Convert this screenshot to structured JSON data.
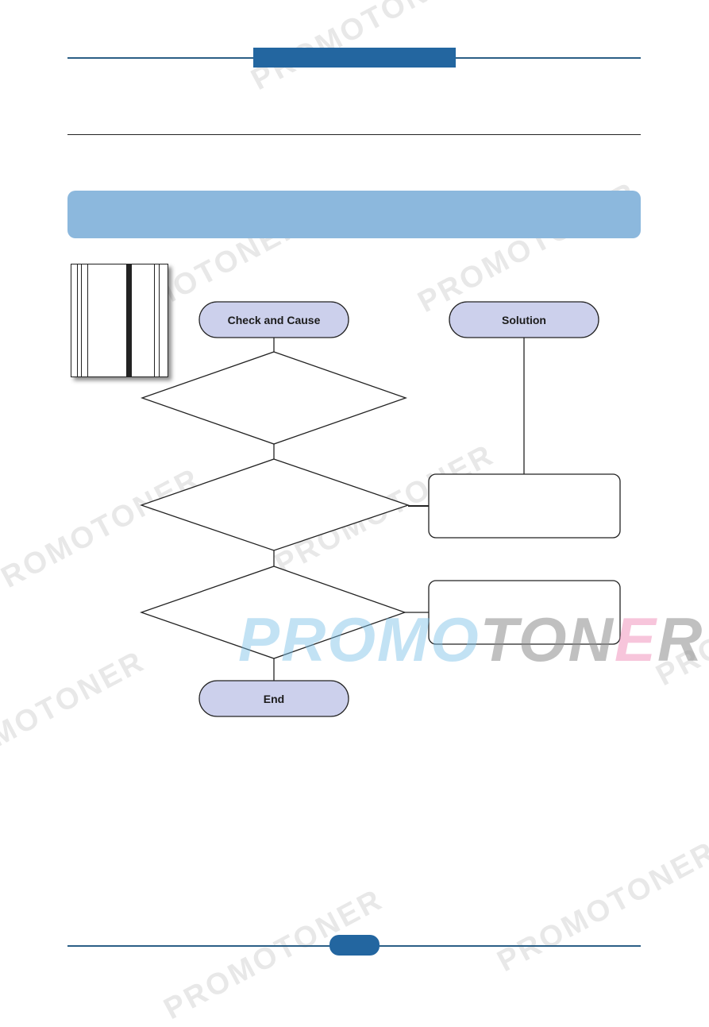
{
  "header": {
    "section_tab": "",
    "title": ""
  },
  "banner": {
    "text": ""
  },
  "sample_image": {
    "icon": "vertical-lines-print-sample",
    "defect": "vertical lines"
  },
  "flowchart": {
    "start_label": "Check and Cause",
    "solution_label": "Solution",
    "end_label": "End",
    "decisions": [
      "",
      "",
      ""
    ],
    "solutions": [
      "",
      ""
    ]
  },
  "footer": {
    "page_number": ""
  },
  "watermark": {
    "text": "PROMOTONER",
    "logo_part1": "PROMO",
    "logo_part2": "TON",
    "logo_part3": "E",
    "logo_part4": "R"
  }
}
